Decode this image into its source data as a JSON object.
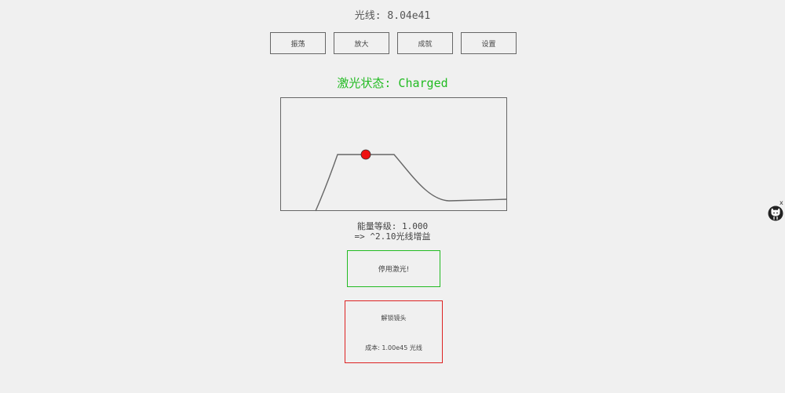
{
  "resource": {
    "label": "光线: 8.04e41"
  },
  "tabs": [
    {
      "label": "振荡"
    },
    {
      "label": "放大"
    },
    {
      "label": "成就"
    },
    {
      "label": "设置"
    }
  ],
  "laser": {
    "status": "激光状态: Charged",
    "status_color": "#22bb22",
    "energy_level": "能量等级: 1.000",
    "boost": "=> ^2.10光线增益"
  },
  "buttons": {
    "toggle_laser": "停用激光!",
    "unlock_title": "解锁镜头",
    "unlock_cost": "成本: 1.00e45 光线"
  },
  "helper": {
    "close_label": "x",
    "icon": "octocat-icon"
  },
  "colors": {
    "accent_green": "#22bb22",
    "accent_red": "#dd2222",
    "marker": "#ee1111"
  }
}
